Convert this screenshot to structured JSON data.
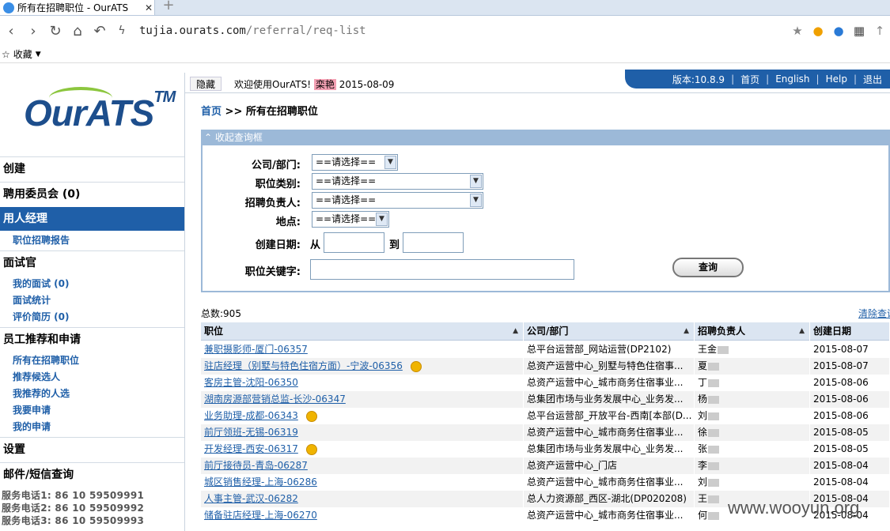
{
  "browser": {
    "tab_title": "所有在招聘职位 - OurATS",
    "url_host": "tujia.ourats.com",
    "url_path": "/referral/req-list",
    "bookmark_label": "收藏"
  },
  "logo": {
    "text": "OurATS",
    "tm": "TM"
  },
  "sidebar": {
    "sections": [
      {
        "label": "创建"
      },
      {
        "label": "聘用委员会 (0)"
      },
      {
        "label": "用人经理"
      },
      {
        "label": "面试官"
      },
      {
        "label": "员工推荐和申请"
      },
      {
        "label": "设置"
      },
      {
        "label": "邮件/短信查询"
      }
    ],
    "hiring_manager_items": [
      "职位招聘报告"
    ],
    "interviewer_items": [
      "我的面试 (0)",
      "面试统计",
      "评价简历 (0)"
    ],
    "referral_items": [
      "所有在招聘职位",
      "推荐候选人",
      "我推荐的人选",
      "我要申请",
      "我的申请"
    ],
    "service_phones": [
      "服务电话1: 86 10 59509991",
      "服务电话2: 86 10 59509992",
      "服务电话3: 86 10 59509993"
    ]
  },
  "top": {
    "hide_label": "隐藏",
    "welcome": "欢迎使用OurATS!",
    "user_name": "栾艳",
    "date": "2015-08-09",
    "version": "版本:10.8.9",
    "links": [
      "首页",
      "English",
      "Help",
      "退出"
    ]
  },
  "breadcrumb": {
    "home": "首页",
    "sep": ">>",
    "current": "所有在招聘职位"
  },
  "query": {
    "header": "收起查询框",
    "company_label": "公司/部门:",
    "category_label": "职位类别:",
    "owner_label": "招聘负责人:",
    "location_label": "地点:",
    "date_label": "创建日期:",
    "from": "从",
    "to": "到",
    "keyword_label": "职位关键字:",
    "select_default": "==请选择==",
    "search_button": "查询"
  },
  "results": {
    "total": "总数:905",
    "clear": "清除查询"
  },
  "table": {
    "headers": [
      "职位",
      "公司/部门",
      "招聘负责人",
      "创建日期"
    ],
    "rows": [
      {
        "title": "兼职摄影师-厦门-06357",
        "dept": "总平台运营部_网站运营(DP2102)",
        "owner": "王金",
        "date": "2015-08-07",
        "coin": false
      },
      {
        "title": "驻店经理（别墅与特色住宿方面）-宁波-06356",
        "dept": "总资产运营中心_别墅与特色住宿事...",
        "owner": "夏",
        "date": "2015-08-07",
        "coin": true
      },
      {
        "title": "客房主管-沈阳-06350",
        "dept": "总资产运营中心_城市商务住宿事业...",
        "owner": "丁",
        "date": "2015-08-06",
        "coin": false
      },
      {
        "title": "湖南房源部营销总监-长沙-06347",
        "dept": "总集团市场与业务发展中心_业务发...",
        "owner": "杨",
        "date": "2015-08-06",
        "coin": false
      },
      {
        "title": "业务助理-成都-06343",
        "dept": "总平台运营部_开放平台-西南[本部(D...",
        "owner": "刘",
        "date": "2015-08-06",
        "coin": true
      },
      {
        "title": "前厅领班-无锡-06319",
        "dept": "总资产运营中心_城市商务住宿事业...",
        "owner": "徐",
        "date": "2015-08-05",
        "coin": false
      },
      {
        "title": "开发经理-西安-06317",
        "dept": "总集团市场与业务发展中心_业务发...",
        "owner": "张",
        "date": "2015-08-05",
        "coin": true
      },
      {
        "title": "前厅接待员-青岛-06287",
        "dept": "总资产运营中心_门店",
        "owner": "李",
        "date": "2015-08-04",
        "coin": false
      },
      {
        "title": "城区销售经理-上海-06286",
        "dept": "总资产运营中心_城市商务住宿事业...",
        "owner": "刘",
        "date": "2015-08-04",
        "coin": false
      },
      {
        "title": "人事主管-武汉-06282",
        "dept": "总人力资源部_西区-湖北(DP020208)",
        "owner": "王",
        "date": "2015-08-04",
        "coin": false
      },
      {
        "title": "储备驻店经理-上海-06270",
        "dept": "总资产运营中心_城市商务住宿事业...",
        "owner": "何",
        "date": "2015-08-04",
        "coin": false
      }
    ]
  },
  "watermark": "www.wooyun.org"
}
